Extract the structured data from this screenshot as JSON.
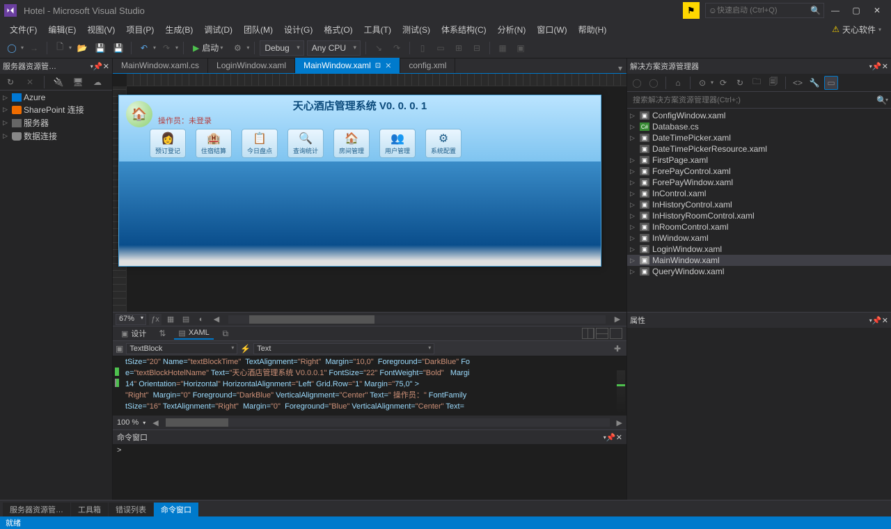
{
  "title": "Hotel - Microsoft Visual Studio",
  "quick_launch_placeholder": "快速启动 (Ctrl+Q)",
  "brand": "天心软件",
  "menus": [
    "文件(F)",
    "编辑(E)",
    "视图(V)",
    "项目(P)",
    "生成(B)",
    "调试(D)",
    "团队(M)",
    "设计(G)",
    "格式(O)",
    "工具(T)",
    "测试(S)",
    "体系结构(C)",
    "分析(N)",
    "窗口(W)",
    "帮助(H)"
  ],
  "toolbar": {
    "run_label": "启动",
    "config": "Debug",
    "platform": "Any CPU"
  },
  "server_explorer": {
    "title": "服务器资源管…",
    "items": [
      "Azure",
      "SharePoint 连接",
      "服务器",
      "数据连接"
    ]
  },
  "tabs": [
    {
      "label": "MainWindow.xaml.cs",
      "active": false
    },
    {
      "label": "LoginWindow.xaml",
      "active": false
    },
    {
      "label": "MainWindow.xaml",
      "active": true,
      "pinned": true
    },
    {
      "label": "config.xml",
      "active": false
    }
  ],
  "designer": {
    "app_title": "天心酒店管理系统  V0. 0. 0. 1",
    "operator_label": "操作员：未登录",
    "buttons": [
      "预订登记",
      "住宿结算",
      "今日盘点",
      "查询统计",
      "房间管理",
      "用户管理",
      "系统配置"
    ],
    "zoom": "67%"
  },
  "split": {
    "design": "设计",
    "xaml": "XAML"
  },
  "breadcrumb": {
    "element": "TextBlock",
    "prop": "Text"
  },
  "code_lines": [
    "tSize=\"20\" Name=\"textBlockTime\"  TextAlignment=\"Right\"  Margin=\"10,0\"  Foreground=\"DarkBlue\" Fo",
    "e=\"textBlockHotelName\" Text=\"天心酒店管理系统 V0.0.0.1\" FontSize=\"22\" FontWeight=\"Bold\"   Margi",
    "14\" Orientation=\"Horizontal\" HorizontalAlignment=\"Left\" Grid.Row=\"1\" Margin=\"75,0\" >",
    "\"Right\"  Margin=\"0\" Foreground=\"DarkBlue\" VerticalAlignment=\"Center\" Text=\" 操作员：\" FontFamily",
    "tSize=\"16\" TextAlignment=\"Right\"  Margin=\"0\"  Foreground=\"Blue\" VerticalAlignment=\"Center\" Text="
  ],
  "code_zoom": "100 %",
  "cmd_title": "命令窗口",
  "cmd_prompt": ">",
  "solution": {
    "title": "解决方案资源管理器",
    "search_placeholder": "搜索解决方案资源管理器(Ctrl+;)",
    "items": [
      {
        "n": "ConfigWindow.xaml",
        "t": "xaml",
        "exp": true
      },
      {
        "n": "Database.cs",
        "t": "cs",
        "exp": true
      },
      {
        "n": "DateTimePicker.xaml",
        "t": "xaml",
        "exp": true
      },
      {
        "n": "DateTimePickerResource.xaml",
        "t": "xaml",
        "exp": false
      },
      {
        "n": "FirstPage.xaml",
        "t": "xaml",
        "exp": true
      },
      {
        "n": "ForePayControl.xaml",
        "t": "xaml",
        "exp": true
      },
      {
        "n": "ForePayWindow.xaml",
        "t": "xaml",
        "exp": true
      },
      {
        "n": "InControl.xaml",
        "t": "xaml",
        "exp": true
      },
      {
        "n": "InHistoryControl.xaml",
        "t": "xaml",
        "exp": true
      },
      {
        "n": "InHistoryRoomControl.xaml",
        "t": "xaml",
        "exp": true
      },
      {
        "n": "InRoomControl.xaml",
        "t": "xaml",
        "exp": true
      },
      {
        "n": "InWindow.xaml",
        "t": "xaml",
        "exp": true
      },
      {
        "n": "LoginWindow.xaml",
        "t": "xaml",
        "exp": true
      },
      {
        "n": "MainWindow.xaml",
        "t": "xaml",
        "exp": true,
        "sel": true
      },
      {
        "n": "QueryWindow.xaml",
        "t": "xaml",
        "exp": true
      }
    ]
  },
  "properties_title": "属性",
  "bottom_tabs": [
    "服务器资源管…",
    "工具箱",
    "错误列表",
    "命令窗口"
  ],
  "bottom_active": 3,
  "status": "就绪"
}
